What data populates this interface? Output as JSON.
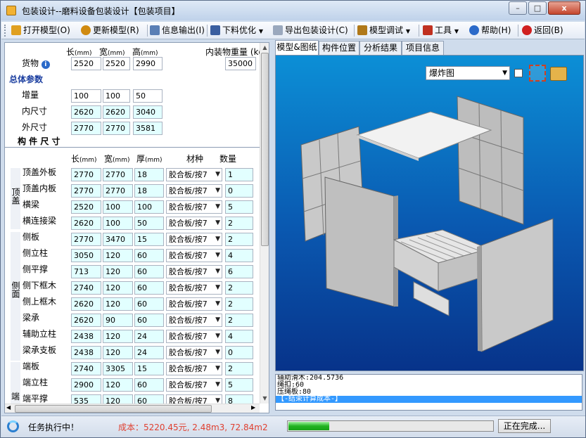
{
  "window": {
    "title": "包装设计--磨料设备包装设计【包装项目】",
    "minimize": "–",
    "maximize": "□",
    "close": "x"
  },
  "toolbar": [
    {
      "label": "打开模型(O)",
      "icon": "folder-open-icon",
      "color": "#e0a020"
    },
    {
      "label": "更新模型(R)",
      "icon": "refresh-icon",
      "color": "#d08a10"
    },
    {
      "label": "信息输出(I)",
      "icon": "info-output-icon",
      "color": "#5a7fb5"
    },
    {
      "label": "下料优化",
      "icon": "cut-optimize-icon",
      "color": "#3b5fa0"
    },
    {
      "label": "导出包装设计(C)",
      "icon": "export-icon",
      "color": "#9aa8bd"
    },
    {
      "label": "模型调试",
      "icon": "debug-icon",
      "color": "#b07818"
    },
    {
      "label": "工具",
      "icon": "tools-icon",
      "color": "#c03020"
    },
    {
      "label": "帮助(H)",
      "icon": "help-icon",
      "color": "#2b6ac9"
    },
    {
      "label": "返回(B)",
      "icon": "power-icon",
      "color": "#d02020"
    }
  ],
  "cargo": {
    "dim_headers": [
      "长",
      "宽",
      "高"
    ],
    "unit": "(mm)",
    "label": "货物",
    "values": [
      "2520",
      "2520",
      "2990"
    ],
    "weight_label": "内装物重量 (kg)",
    "weight": "35000"
  },
  "overall": {
    "title": "总体参数",
    "rows": [
      {
        "label": "增量",
        "values": [
          "100",
          "100",
          "50"
        ]
      },
      {
        "label": "内尺寸",
        "values": [
          "2620",
          "2620",
          "3040"
        ]
      },
      {
        "label": "外尺寸",
        "values": [
          "2770",
          "2770",
          "3581"
        ]
      }
    ]
  },
  "components": {
    "title": "构 件 尺 寸",
    "headers": [
      "长",
      "宽",
      "厚",
      "材种",
      "数量"
    ],
    "unit": "(mm)",
    "groups": [
      "顶盖",
      "侧面",
      "端"
    ],
    "rows": [
      {
        "label": "顶盖外板",
        "l": "2770",
        "w": "2770",
        "t": "18",
        "mat": "胶合板/按7",
        "qty": "1"
      },
      {
        "label": "顶盖内板",
        "l": "2770",
        "w": "2770",
        "t": "18",
        "mat": "胶合板/按7",
        "qty": "0"
      },
      {
        "label": "横梁",
        "l": "2520",
        "w": "100",
        "t": "100",
        "mat": "胶合板/按7",
        "qty": "5"
      },
      {
        "label": "横连接梁",
        "l": "2620",
        "w": "100",
        "t": "50",
        "mat": "胶合板/按7",
        "qty": "2"
      },
      {
        "label": "侧板",
        "l": "2770",
        "w": "3470",
        "t": "15",
        "mat": "胶合板/按7",
        "qty": "2"
      },
      {
        "label": "侧立柱",
        "l": "3050",
        "w": "120",
        "t": "60",
        "mat": "胶合板/按7",
        "qty": "4"
      },
      {
        "label": "侧平撑",
        "l": "713",
        "w": "120",
        "t": "60",
        "mat": "胶合板/按7",
        "qty": "6"
      },
      {
        "label": "侧下框木",
        "l": "2740",
        "w": "120",
        "t": "60",
        "mat": "胶合板/按7",
        "qty": "2"
      },
      {
        "label": "侧上框木",
        "l": "2620",
        "w": "120",
        "t": "60",
        "mat": "胶合板/按7",
        "qty": "2"
      },
      {
        "label": "梁承",
        "l": "2620",
        "w": "90",
        "t": "60",
        "mat": "胶合板/按7",
        "qty": "2"
      },
      {
        "label": "辅助立柱",
        "l": "2438",
        "w": "120",
        "t": "24",
        "mat": "胶合板/按7",
        "qty": "4"
      },
      {
        "label": "梁承支板",
        "l": "2438",
        "w": "120",
        "t": "24",
        "mat": "胶合板/按7",
        "qty": "0"
      },
      {
        "label": "端板",
        "l": "2740",
        "w": "3305",
        "t": "15",
        "mat": "胶合板/按7",
        "qty": "2"
      },
      {
        "label": "端立柱",
        "l": "2900",
        "w": "120",
        "t": "60",
        "mat": "胶合板/按7",
        "qty": "5"
      },
      {
        "label": "端平撑",
        "l": "535",
        "w": "120",
        "t": "60",
        "mat": "胶合板/按7",
        "qty": "8"
      }
    ]
  },
  "tabs": [
    "模型&图纸",
    "构件位置",
    "分析结果",
    "项目信息"
  ],
  "view": {
    "mode": "爆炸图"
  },
  "log": [
    "辅助滑木:204.5736",
    "绳扣:60",
    "压绳板:80",
    "【-结束计算成本-】"
  ],
  "status": {
    "task": "任务执行中！",
    "cost": "成本：5220.45元, 2.48m3, 72.84m2",
    "progress": 0.2,
    "done_button": "正在完成..."
  }
}
